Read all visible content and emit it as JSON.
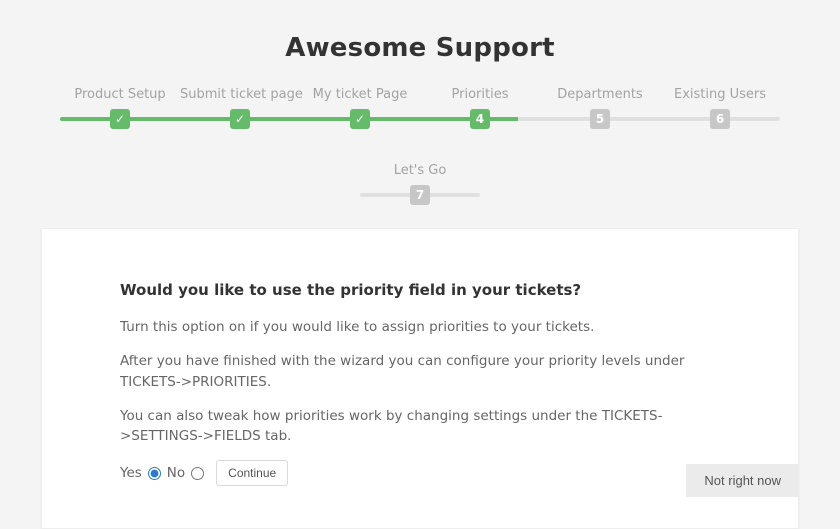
{
  "title": "Awesome Support",
  "stepper": {
    "row1": [
      {
        "label": "Product Setup",
        "state": "done",
        "badge": "✓"
      },
      {
        "label": "Submit ticket page",
        "state": "done",
        "badge": "✓"
      },
      {
        "label": "My ticket Page",
        "state": "done",
        "badge": "✓"
      },
      {
        "label": "Priorities",
        "state": "current",
        "badge": "4"
      },
      {
        "label": "Departments",
        "state": "pending",
        "badge": "5"
      },
      {
        "label": "Existing Users",
        "state": "pending",
        "badge": "6"
      }
    ],
    "row2": [
      {
        "label": "Let's Go",
        "state": "pending",
        "badge": "7"
      }
    ]
  },
  "card": {
    "heading": "Would you like to use the priority field in your tickets?",
    "p1": "Turn this option on if you would like to assign priorities to your tickets.",
    "p2": "After you have finished with the wizard you can configure your priority levels under TICKETS->PRIORITIES.",
    "p3": "You can also tweak how priorities work by changing settings under the TICKETS->SETTINGS->FIELDS tab.",
    "yes_label": "Yes",
    "no_label": "No",
    "selected": "yes",
    "continue_label": "Continue"
  },
  "footer": {
    "skip_label": "Not right now"
  }
}
